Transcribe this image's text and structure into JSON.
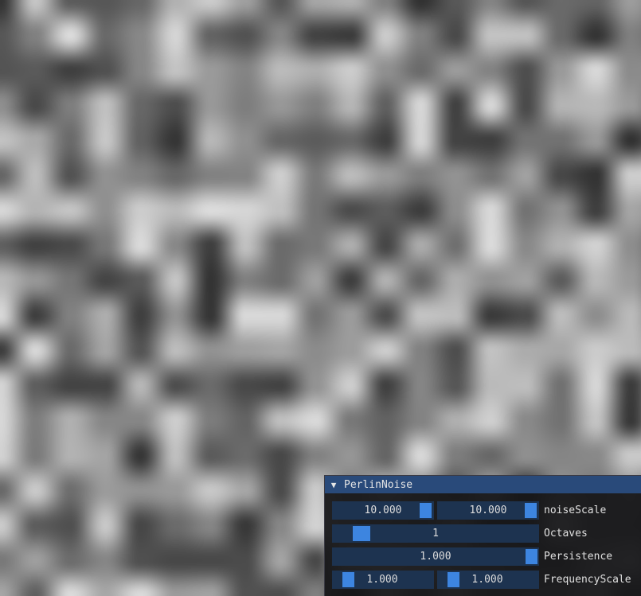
{
  "window": {
    "title": "PerlinNoise",
    "collapse_icon": "triangle-down-icon",
    "title_color": "#294a7a",
    "slider_color": "#1d3350",
    "grab_color": "#3d85e0"
  },
  "controls": {
    "noise_scale": {
      "label": "noiseScale",
      "x": "10.000",
      "y": "10.000",
      "x_level": 1.0,
      "y_level": 1.0
    },
    "octaves": {
      "label": "Octaves",
      "value": "1",
      "level": 0.0
    },
    "persistence": {
      "label": "Persistence",
      "value": "1.000",
      "level": 1.0
    },
    "frequency_scale": {
      "label": "FrequencyScale",
      "x": "1.000",
      "y": "1.000",
      "x_level": 0.0,
      "y_level": 0.0
    }
  }
}
